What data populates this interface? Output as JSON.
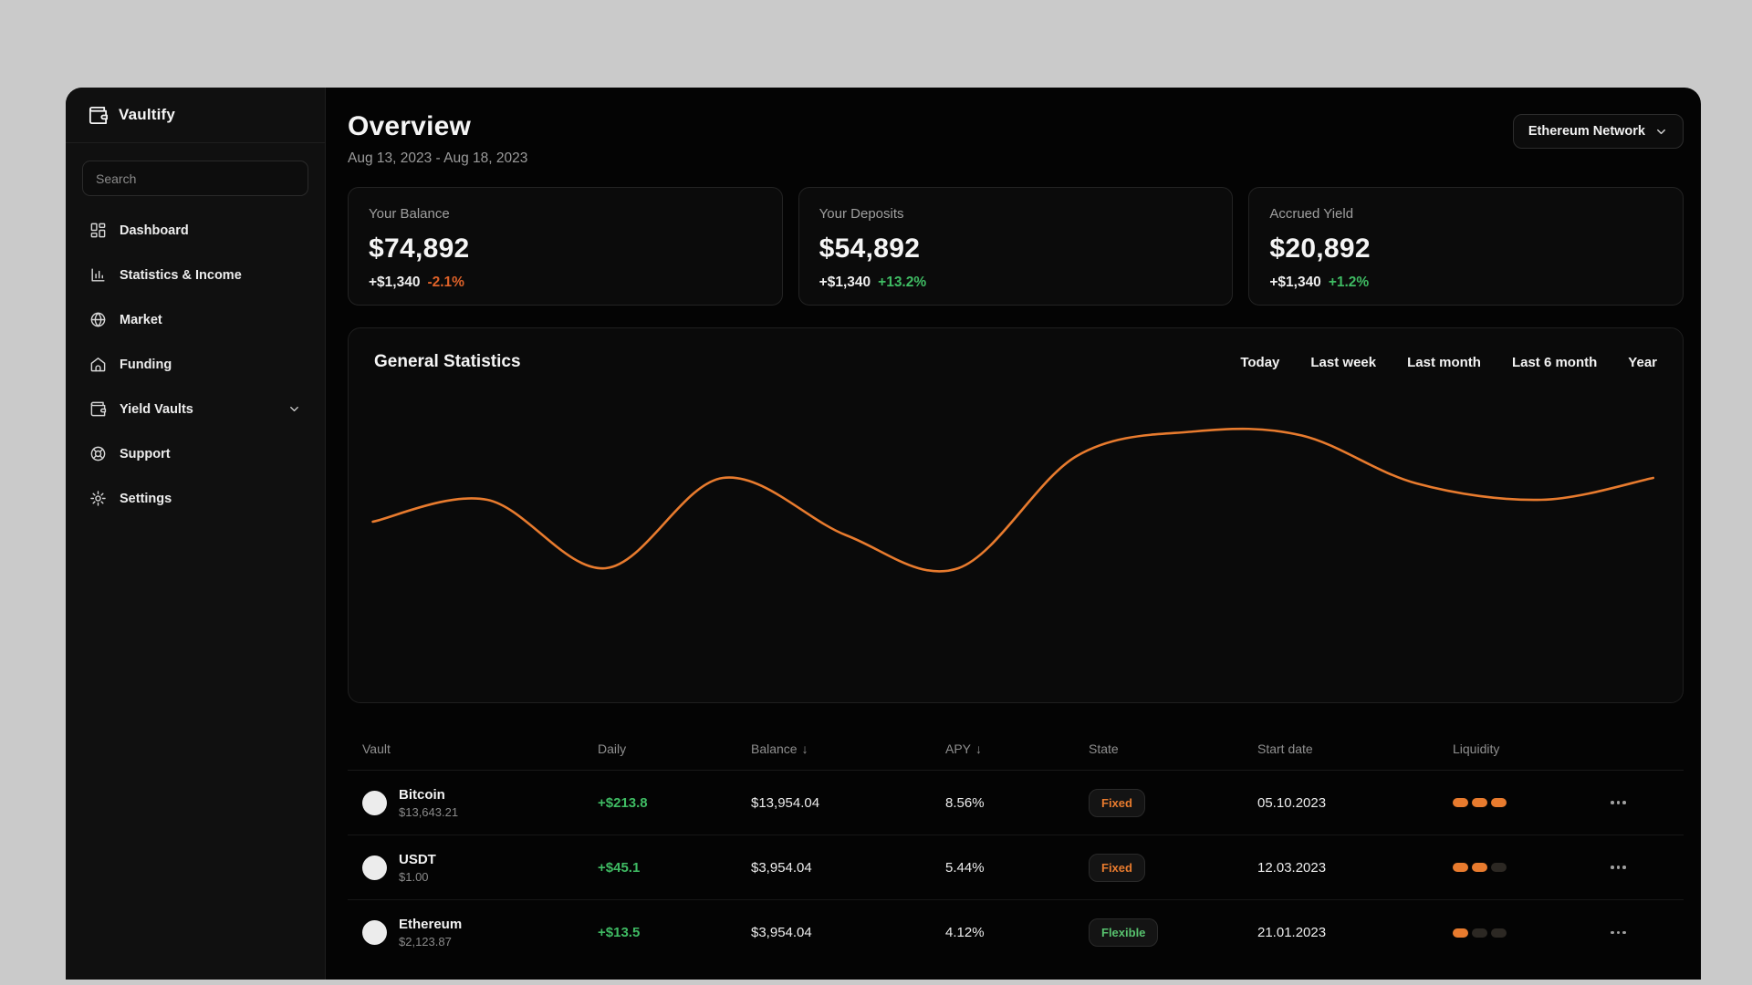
{
  "theme": {
    "page_background": "#cacaca",
    "main_background": "#040404",
    "sidebar_background": "#101010",
    "card_background": "#0b0b0b",
    "accent_orange": "#e87b2e",
    "positive_green": "#3fbb63",
    "negative_orange": "#df6229"
  },
  "sidebar": {
    "brand": "Vaultify",
    "search_placeholder": "Search",
    "items": [
      {
        "label": "Dashboard",
        "icon": "dashboard-icon"
      },
      {
        "label": "Statistics & Income",
        "icon": "bar-chart-icon"
      },
      {
        "label": "Market",
        "icon": "globe-icon"
      },
      {
        "label": "Funding",
        "icon": "home-icon"
      },
      {
        "label": "Yield Vaults",
        "icon": "wallet-icon",
        "has_chevron": true
      },
      {
        "label": "Support",
        "icon": "life-buoy-icon"
      },
      {
        "label": "Settings",
        "icon": "gear-icon"
      }
    ]
  },
  "header": {
    "title": "Overview",
    "date_range": "Aug 13, 2023 - Aug 18, 2023",
    "network_selector": "Ethereum Network"
  },
  "cards": [
    {
      "label": "Your Balance",
      "value": "$74,892",
      "change": "+$1,340",
      "change_pct": "-2.1%",
      "trend": "negative"
    },
    {
      "label": "Your Deposits",
      "value": "$54,892",
      "change": "+$1,340",
      "change_pct": "+13.2%",
      "trend": "positive"
    },
    {
      "label": "Accrued Yield",
      "value": "$20,892",
      "change": "+$1,340",
      "change_pct": "+1.2%",
      "trend": "positive"
    }
  ],
  "statistics": {
    "title": "General Statistics",
    "filters": [
      "Today",
      "Last week",
      "Last month",
      "Last 6 month",
      "Year"
    ],
    "chart_data": {
      "type": "line",
      "title": "General Statistics",
      "xlabel": "",
      "ylabel": "",
      "axes_visible": false,
      "grid": false,
      "legend": false,
      "line_color": "#e87b2e",
      "series": [
        {
          "name": "General Statistics",
          "x_pct": [
            0.6,
            9.4,
            18.5,
            27.5,
            37,
            45.6,
            54.7,
            63.8,
            72,
            80.8,
            90.4,
            99
          ],
          "y_pct": [
            62,
            70,
            45,
            78,
            57,
            45,
            86,
            95,
            93.5,
            76,
            70,
            78
          ]
        }
      ]
    }
  },
  "table": {
    "columns": [
      {
        "label": "Vault"
      },
      {
        "label": "Daily"
      },
      {
        "label": "Balance",
        "sort": "↓"
      },
      {
        "label": "APY",
        "sort": "↓"
      },
      {
        "label": "State"
      },
      {
        "label": "Start date"
      },
      {
        "label": "Liquidity"
      }
    ],
    "rows": [
      {
        "asset": "Bitcoin",
        "price": "$13,643.21",
        "daily": "+$213.8",
        "balance": "$13,954.04",
        "apy": "8.56%",
        "state": "Fixed",
        "state_type": "fixed",
        "start_date": "05.10.2023",
        "liquidity_filled": 3,
        "liquidity_total": 3
      },
      {
        "asset": "USDT",
        "price": "$1.00",
        "daily": "+$45.1",
        "balance": "$3,954.04",
        "apy": "5.44%",
        "state": "Fixed",
        "state_type": "fixed",
        "start_date": "12.03.2023",
        "liquidity_filled": 2,
        "liquidity_total": 3
      },
      {
        "asset": "Ethereum",
        "price": "$2,123.87",
        "daily": "+$13.5",
        "balance": "$3,954.04",
        "apy": "4.12%",
        "state": "Flexible",
        "state_type": "flexible",
        "start_date": "21.01.2023",
        "liquidity_filled": 1,
        "liquidity_total": 3
      }
    ]
  }
}
